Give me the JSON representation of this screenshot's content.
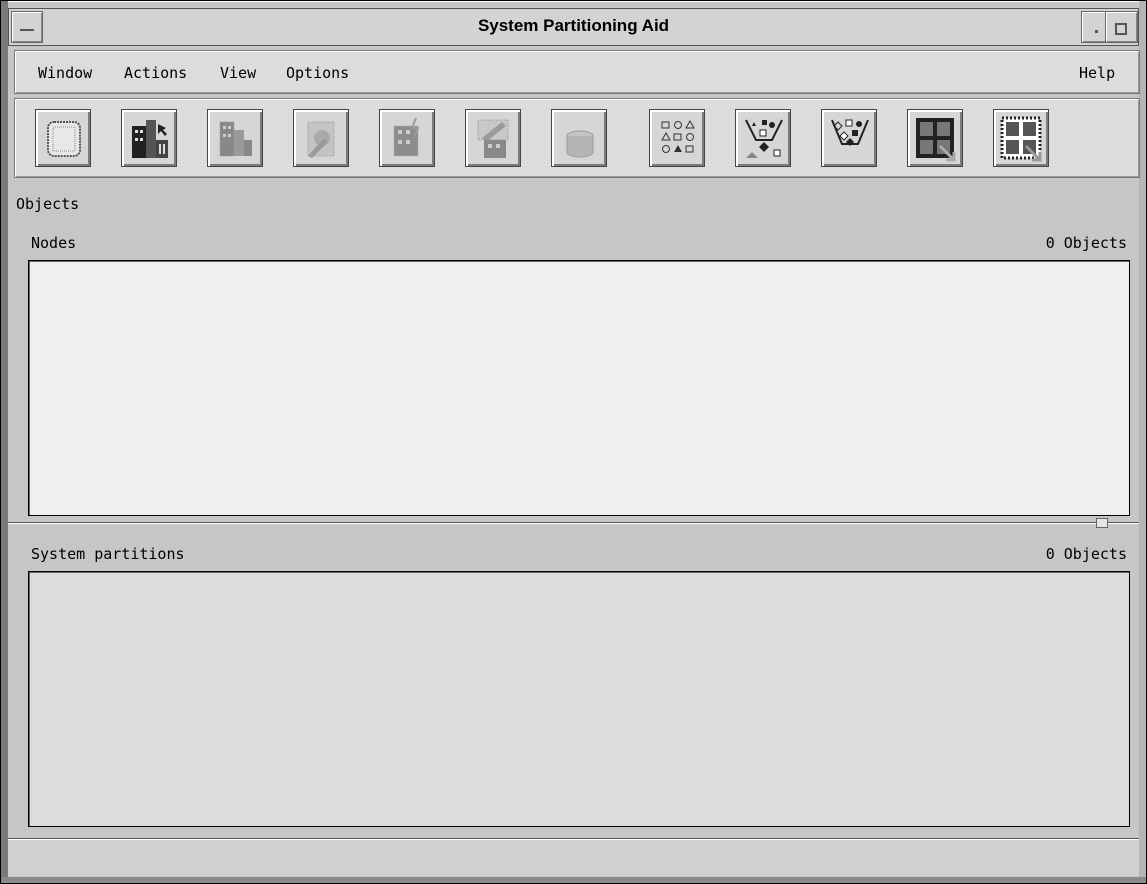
{
  "window": {
    "title": "System Partitioning Aid"
  },
  "menubar": {
    "items": [
      {
        "label": "Window"
      },
      {
        "label": "Actions"
      },
      {
        "label": "View"
      },
      {
        "label": "Options"
      }
    ],
    "help_label": "Help"
  },
  "toolbar": {
    "buttons": [
      {
        "icon": "node-frame-icon"
      },
      {
        "icon": "building-cursor-icon"
      },
      {
        "icon": "building-disabled-icon"
      },
      {
        "icon": "edit-node-disabled-icon"
      },
      {
        "icon": "building-lightning-disabled-icon"
      },
      {
        "icon": "building-pencil-disabled-icon"
      },
      {
        "icon": "cylinder-disabled-icon"
      },
      {
        "icon": "shapes-grid-icon"
      },
      {
        "icon": "shapes-filter-icon"
      },
      {
        "icon": "shapes-filter-outline-icon"
      },
      {
        "icon": "grid-resize-icon"
      },
      {
        "icon": "grid-dotted-resize-icon"
      }
    ]
  },
  "objects": {
    "heading": "Objects",
    "nodes": {
      "label": "Nodes",
      "count": "0 Objects"
    },
    "system_partitions": {
      "label": "System partitions",
      "count": "0 Objects"
    }
  },
  "colors": {
    "window_bg": "#c6c6c6",
    "nodes_list_bg": "#efefef",
    "partitions_list_bg": "#dcdcdc"
  }
}
